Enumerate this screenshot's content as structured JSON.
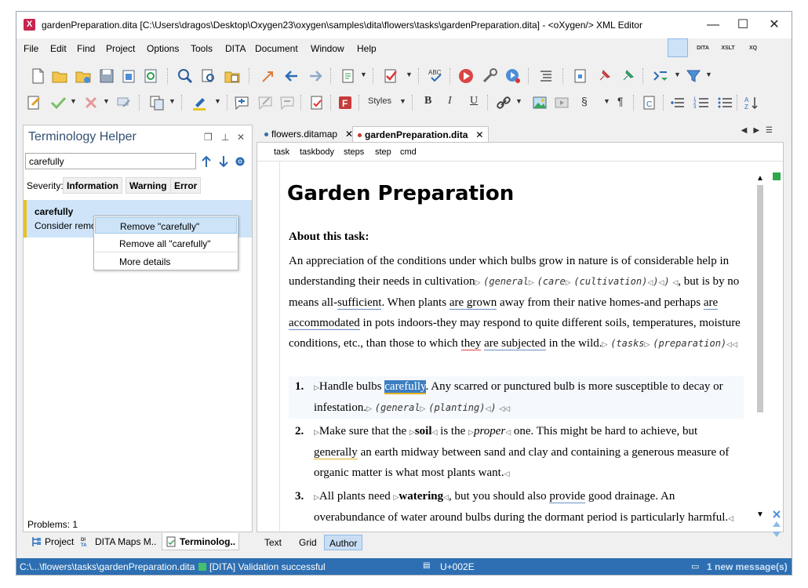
{
  "window": {
    "title": "gardenPreparation.dita [C:\\Users\\dragos\\Desktop\\Oxygen23\\oxygen\\samples\\dita\\flowers\\tasks\\gardenPreparation.dita] - <oXygen/> XML Editor",
    "app_icon": "X",
    "minimize": "—",
    "maximize": "☐",
    "close": "✕"
  },
  "menu": [
    "File",
    "Edit",
    "Find",
    "Project",
    "Options",
    "Tools",
    "DITA",
    "Document",
    "Window",
    "Help"
  ],
  "perspectives": [
    "",
    "DITA",
    "XSLT",
    "XQ",
    ""
  ],
  "toolbar": {
    "styles_label": "Styles",
    "bold": "B",
    "italic": "I",
    "underline": "U",
    "section": "§",
    "pilcrow": "¶"
  },
  "terminology": {
    "title": "Terminology Helper",
    "search_value": "carefully",
    "severity_label": "Severity:",
    "severity_buttons": [
      "Information",
      "Warning",
      "Error"
    ],
    "result_word": "carefully",
    "result_desc": "Consider remov",
    "context_menu": [
      "Remove \"carefully\"",
      "Remove all \"carefully\"",
      "More details"
    ],
    "problems": "Problems: 1"
  },
  "left_tabs": [
    "Project",
    "DITA Maps M..",
    "Terminolog.."
  ],
  "editor_tabs": [
    {
      "label": "flowers.ditamap"
    },
    {
      "label": "gardenPreparation.dita"
    }
  ],
  "breadcrumb": [
    "task",
    "taskbody",
    "steps",
    "step",
    "cmd"
  ],
  "document": {
    "title": "Garden Preparation",
    "about_heading": "About this task:",
    "p1_a": "An appreciation of the conditions under which bulbs grow in nature is of considerable help in understanding their needs in cultivation",
    "ix1": "(general",
    "ix2": "(care",
    "ix3": "(cultivation)",
    "p1_b": ", but is by no means all-",
    "w_sufficient": "sufficient",
    "p1_c": ". When plants ",
    "w_are_grown": "are grown",
    "p1_d": " away from their native homes-and perhaps ",
    "w_are_accommodated": "are accommodated",
    "p1_e": " in pots indoors-they may respond to quite different soils, temperatures, moisture conditions, etc., than those to which ",
    "w_they": "they",
    "w_are_subjected": "are subjected",
    "p1_f": " in the wild.",
    "ix4": "(tasks",
    "ix5": "(preparation)",
    "step1_num": "1.",
    "step1_a": "Handle bulbs ",
    "step1_sel": "carefully",
    "step1_b": ". Any scarred or punctured bulb is more susceptible to decay or infestation.",
    "ix6": "(general",
    "ix7": "(planting)",
    "step2_num": "2.",
    "step2_a": "Make sure that the ",
    "step2_soil": "soil",
    "step2_b": " is the ",
    "step2_proper": "proper",
    "step2_c": " one. This might be hard to achieve, but ",
    "step2_generally": "generally",
    "step2_d": " an earth midway between sand and clay and containing a generous measure of organic matter is what most plants want.",
    "step3_num": "3.",
    "step3_a": "All plants need ",
    "step3_watering": "watering",
    "step3_b": ", but you should also ",
    "step3_provide": "provide",
    "step3_c": " good drainage. An overabundance of water around bulbs during the dormant period is particularly harmful."
  },
  "mode_tabs": [
    "Text",
    "Grid",
    "Author"
  ],
  "status": {
    "path": "C:\\...\\flowers\\tasks\\gardenPreparation.dita",
    "validation": "[DITA] Validation successful",
    "unicode": "U+002E",
    "messages": "1 new message(s)"
  }
}
